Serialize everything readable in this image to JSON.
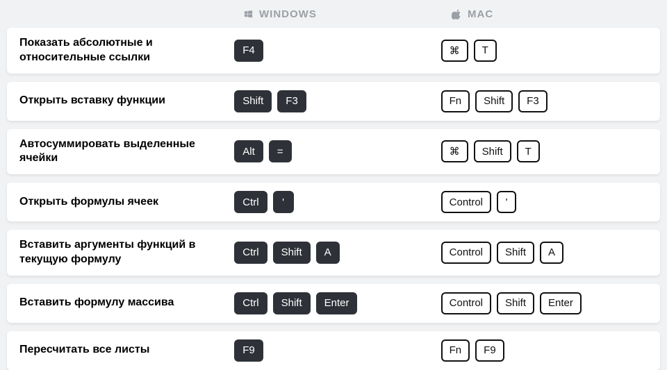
{
  "header": {
    "windows": "WINDOWS",
    "mac": "MAC"
  },
  "rows": [
    {
      "desc": "Показать абсолютные и относительные ссылки",
      "win": [
        "F4"
      ],
      "mac": [
        "⌘",
        "T"
      ]
    },
    {
      "desc": "Открыть вставку функции",
      "win": [
        "Shift",
        "F3"
      ],
      "mac": [
        "Fn",
        "Shift",
        "F3"
      ]
    },
    {
      "desc": "Автосуммировать выделенные ячейки",
      "win": [
        "Alt",
        "="
      ],
      "mac": [
        "⌘",
        "Shift",
        "T"
      ]
    },
    {
      "desc": "Открыть формулы ячеек",
      "win": [
        "Ctrl",
        "'"
      ],
      "mac": [
        "Control",
        "'"
      ]
    },
    {
      "desc": "Вставить аргументы функций в текущую формулу",
      "win": [
        "Ctrl",
        "Shift",
        "A"
      ],
      "mac": [
        "Control",
        "Shift",
        "A"
      ]
    },
    {
      "desc": "Вставить формулу массива",
      "win": [
        "Ctrl",
        "Shift",
        "Enter"
      ],
      "mac": [
        "Control",
        "Shift",
        "Enter"
      ]
    },
    {
      "desc": "Пересчитать все листы",
      "win": [
        "F9"
      ],
      "mac": [
        "Fn",
        "F9"
      ]
    }
  ]
}
